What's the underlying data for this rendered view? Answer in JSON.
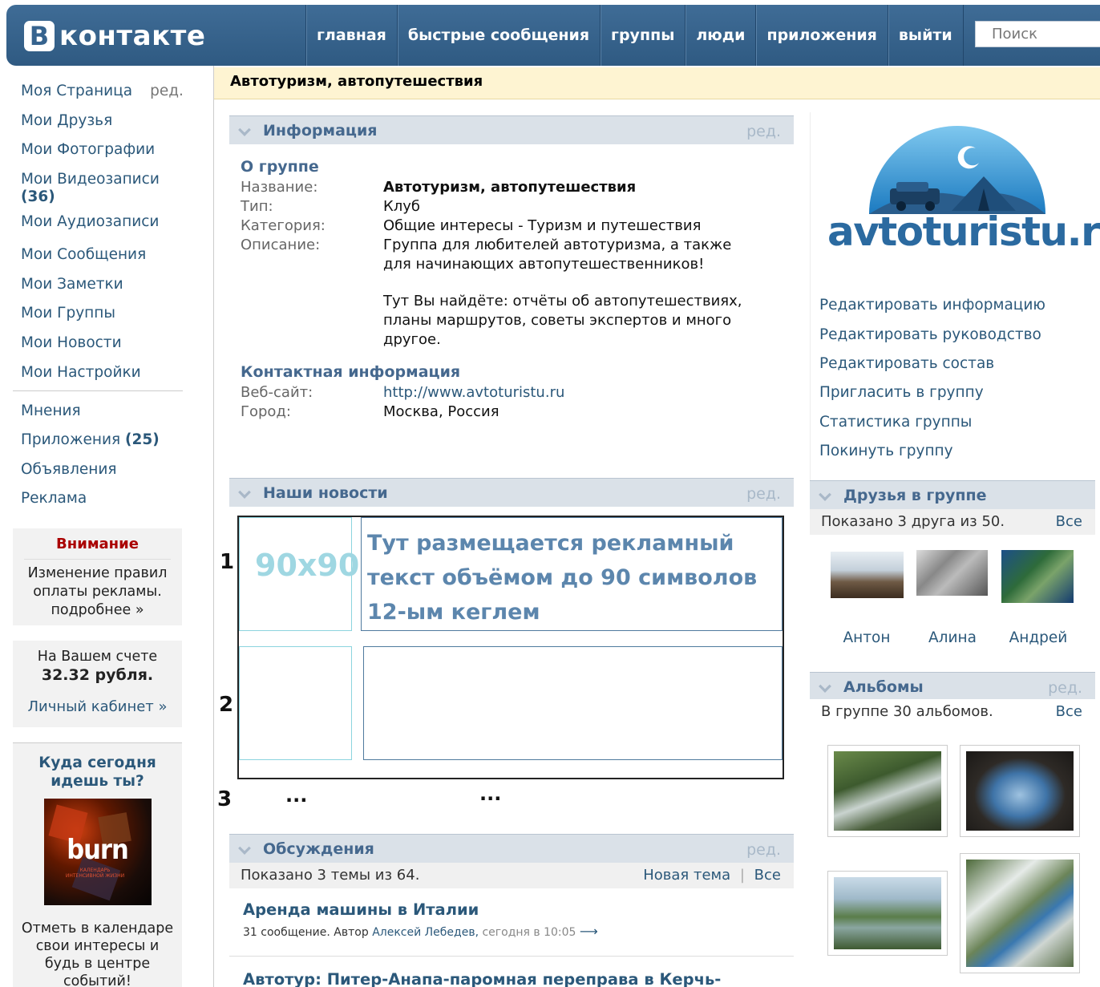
{
  "header": {
    "logo_letter": "В",
    "logo_text": "контакте",
    "nav": [
      "главная",
      "быстрые сообщения",
      "группы",
      "люди",
      "приложения",
      "выйти"
    ],
    "search_placeholder": "Поиск"
  },
  "left_menu": {
    "my_page": "Моя Страница",
    "edit": "ред.",
    "friends": "Мои Друзья",
    "photos": "Мои Фотографии",
    "videos": "Мои Видеозаписи",
    "videos_count": "(36)",
    "audio": "Мои Аудиозаписи",
    "messages": "Мои Сообщения",
    "notes": "Мои Заметки",
    "groups": "Мои Группы",
    "news": "Мои Новости",
    "settings": "Мои Настройки",
    "opinions": "Мнения",
    "apps": "Приложения",
    "apps_count": "(25)",
    "ads": "Объявления",
    "advert": "Реклама"
  },
  "notice": {
    "title": "Внимание",
    "text": "Изменение правил оплаты рекламы.",
    "more": "подробнее »"
  },
  "account": {
    "line1": "На Вашем счете",
    "sum": "32.32 рубля.",
    "link": "Личный кабинет »"
  },
  "promo": {
    "title": "Куда сегодня идешь ты?",
    "image_word": "burn",
    "image_sub": "КАЛЕНДАРЬ ИНТЕНСИВНОЙ ЖИЗНИ",
    "text": "Отметь в календаре свои интересы и будь в центре событий!"
  },
  "page_title": "Автотуризм, автопутешествия",
  "info": {
    "section_title": "Информация",
    "edit": "ред.",
    "about_heading": "О группе",
    "name_label": "Название:",
    "name_value": "Автотуризм, автопутешествия",
    "type_label": "Тип:",
    "type_value": "Клуб",
    "category_label": "Категория:",
    "category_value": "Общие интересы - Туризм и путешествия",
    "desc_label": "Описание:",
    "desc_p1": "Группа для любителей автотуризма, а также для начинающих автопутешественников!",
    "desc_p2": "Тут Вы найдёте: отчёты об автопутешествиях, планы маршрутов, советы экспертов и много другое.",
    "contact_heading": "Контактная информация",
    "website_label": "Веб-сайт:",
    "website_value": "http://www.avtoturistu.ru",
    "city_label": "Город:",
    "city_value": "Москва, Россия"
  },
  "news": {
    "section_title": "Наши новости",
    "edit": "ред.",
    "num1": "1",
    "num2": "2",
    "num3": "3",
    "image_size": "90x90",
    "ad_text": "Тут размещается рекламный текст объёмом до 90 символов 12-ым кеглем",
    "dots": "..."
  },
  "discussions": {
    "section_title": "Обсуждения",
    "edit": "ред.",
    "shown": "Показано 3 темы из 64.",
    "new_topic": "Новая тема",
    "sep": "|",
    "all": "Все",
    "topic1_title": "Аренда машины в Италии",
    "topic1_count": "31 сообщение. Автор",
    "topic1_author": "Алексей Лебедев,",
    "topic1_time": "сегодня в 10:05",
    "topic1_arrow": "⟶",
    "topic2_title": "Автотур: Питер-Анапа-паромная переправа в Керчь-"
  },
  "right": {
    "logo_word": "avtoturistu.ru",
    "links": [
      "Редактировать информацию",
      "Редактировать руководство",
      "Редактировать состав",
      "Пригласить в группу",
      "Статистика группы",
      "Покинуть группу"
    ],
    "friends_title": "Друзья в группе",
    "friends_shown": "Показано 3 друга из 50.",
    "friends_all": "Все",
    "friends": [
      "Антон",
      "Алина",
      "Андрей"
    ],
    "albums_title": "Альбомы",
    "albums_edit": "ред.",
    "albums_count": "В группе 30 альбомов.",
    "albums_all": "Все"
  },
  "colors": {
    "header_blue": "#36638e",
    "link_blue": "#2b587a",
    "section_bg": "#dae1e8",
    "title_bar_bg": "#fef4d2",
    "notice_red": "#aa0000"
  }
}
